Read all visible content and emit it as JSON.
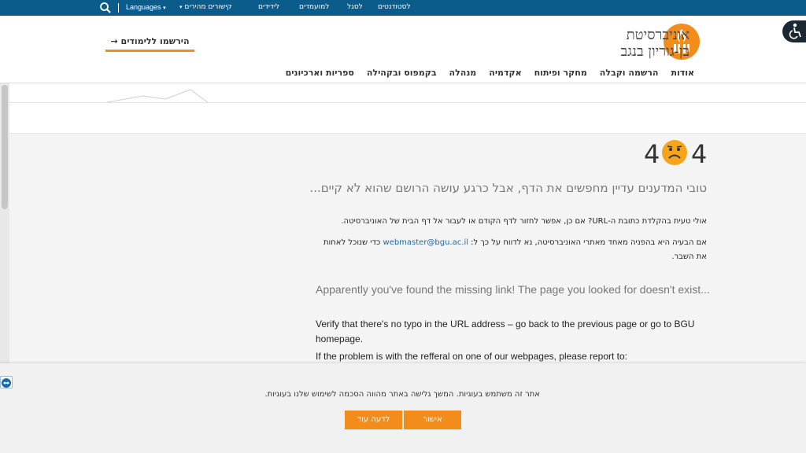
{
  "topbar": {
    "languages_label": "Languages",
    "quick_links_label": "קישורים מהירים",
    "links": [
      "למועמדים",
      "לסגל",
      "לסטודנטים",
      "לידידים"
    ]
  },
  "header": {
    "logo_line1": "אוניברסיטת",
    "logo_line2": "בן-גוריון בנגב",
    "cta_label": "הירשמו ללימודים",
    "nav": [
      "אודות",
      "הרשמה וקבלה",
      "מחקר ופיתוח",
      "אקדמיה",
      "מנהלה",
      "בקמפוס ובקהילה",
      "ספריות וארכיונים"
    ]
  },
  "error": {
    "digit_left": "4",
    "digit_right": "4",
    "he_lead": "טובי המדענים עדיין מחפשים את הדף, אבל כרגע עושה הרושם שהוא לא קיים...",
    "he_p1": "אולי טעית בהקלדת כתובת ה-URL? אם כן, אפשר לחזור לדף הקודם או לעבור אל דף הבית של האוניברסיטה.",
    "he_p2_before": "אם הבעיה היא בהפניה מאחד מאתרי האוניברסיטה, נא לדווח על כך ל: ",
    "he_p2_email": "webmaster@bgu.ac.il",
    "he_p2_after": " כדי שנוכל לאחות את השבר.",
    "en_lead": "Apparently you've found the missing link!  The page you looked for doesn't exist...",
    "en_p1": "Verify that there's no typo in the URL address – go back to the previous page or go to BGU homepage.",
    "en_p2": "If the problem is with the refferal on one of our webpages, please report to:"
  },
  "cookie": {
    "message": "אתר זה משתמש בעוגיות. המשך גלישה באתר מהווה הסכמה לשימוש שלנו בעוגיות.",
    "ok_label": "אישור",
    "more_label": "לדעה עוד"
  },
  "colors": {
    "topbar": "#0b5c8a",
    "accent": "#f28c1a",
    "link": "#1a6aa8"
  },
  "icons": [
    "search-icon",
    "accessibility-icon",
    "sad-face-icon",
    "teamviewer-icon",
    "university-logo"
  ]
}
